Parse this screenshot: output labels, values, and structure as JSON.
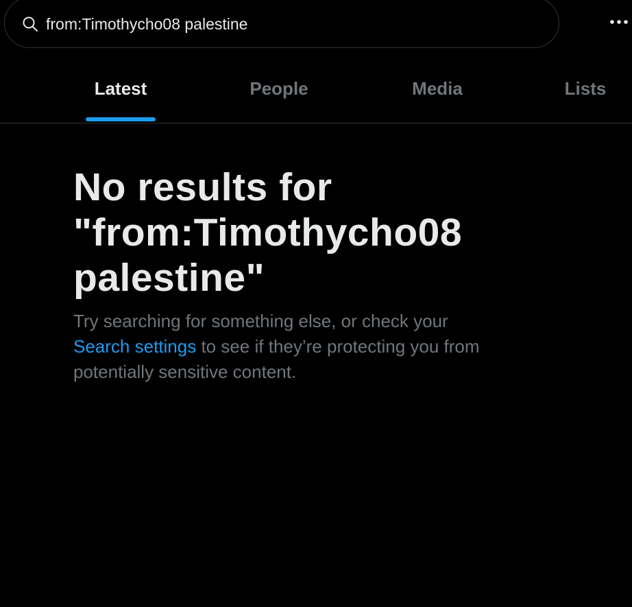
{
  "search": {
    "value": "from:Timothycho08 palestine",
    "icon": "search-icon"
  },
  "more_menu": {
    "icon": "more-horizontal-icon"
  },
  "tabs": [
    {
      "label": "Latest",
      "active": true
    },
    {
      "label": "People",
      "active": false
    },
    {
      "label": "Media",
      "active": false
    },
    {
      "label": "Lists",
      "active": false
    }
  ],
  "empty_state": {
    "title": "No results for \"from:Timothycho08 palestine\"",
    "desc_before": "Try searching for something else, or check your ",
    "link_text": "Search settings",
    "desc_after": " to see if they’re protecting you from potentially sensitive content."
  },
  "colors": {
    "background": "#000000",
    "accent": "#1d9bf0",
    "primary_text": "#e7e9ea",
    "secondary_text": "#71767b",
    "border": "#2f3336"
  }
}
